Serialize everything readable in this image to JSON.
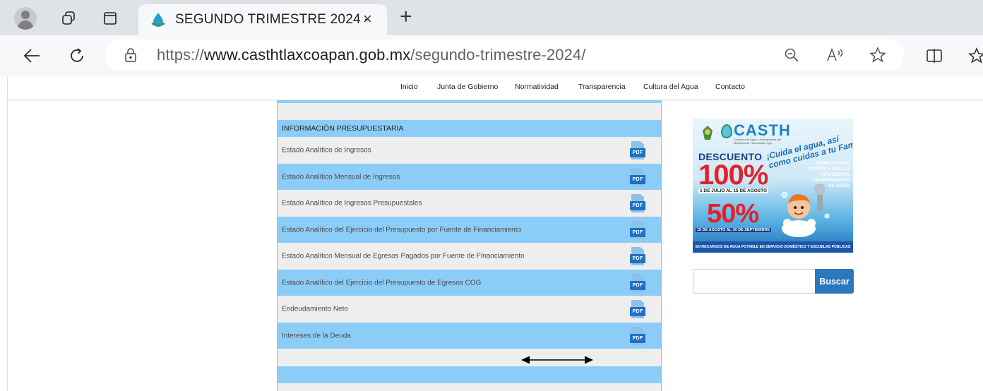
{
  "browser": {
    "tab_title": "SEGUNDO TRIMESTRE 2024 -",
    "tab_close_glyph": "×",
    "new_tab_glyph": "+",
    "url_scheme": "https://",
    "url_domain": "www.casthtlaxcoapan.gob.mx",
    "url_path": "/segundo-trimestre-2024/",
    "icons": [
      "profile-avatar",
      "workspaces-icon",
      "tab-actions-icon",
      "back-icon",
      "refresh-icon",
      "site-info-icon",
      "zoom-out-icon",
      "read-aloud-icon",
      "favorite-star-icon",
      "split-screen-icon",
      "favorites-icon"
    ]
  },
  "nav": {
    "items": [
      "Inicio",
      "Junta de Gobierno",
      "Normatividad",
      "Transparencia",
      "Cultura del Agua",
      "Contacto"
    ]
  },
  "table": {
    "header": "INFORMACIÓN PRESUPUESTARIA",
    "pdf_label": "PDF",
    "rows": [
      "Estado Analítico de Ingresos",
      "Estado Analítico Mensual de Ingresos",
      "Estado Analítico de Ingresos Presupuestales",
      "Estado Analítico del Ejercicio del Presupuesto por Fuente de Financiamiento",
      " Estado Analítico Mensual de Egresos Pagados por Fuente de Financiamiento",
      "Estado Analítico del Ejercicio del Presupuesto de Egresos COG",
      "Endeudamiento Neto",
      "Intereses de la Deuda"
    ],
    "colors": {
      "blue_row": "#8ccdf7",
      "gray_row": "#eeeeee",
      "pdf_icon": "#1d72c6"
    }
  },
  "banner": {
    "brand": "CASTH",
    "brand_sub": "Comisión de Agua y Saneamiento del Municipio de Tlaxcoapan, Hgo.",
    "slogan_line1": "¡Cuida el agua, así",
    "slogan_line2": "como cuidas a tu Familia!",
    "discount_word": "DESCUENTO",
    "discount_100": "100%",
    "date_range_1": "1 DE JULIO AL 15 DE AGOSTO",
    "tip_lines": [
      "TOMA DUCHAS",
      "CORTAS Y UTILIZA",
      "REGADERAS",
      "AHORRADORAS",
      "DE AGUA"
    ],
    "discount_50": "50%",
    "date_range_2": "15 DE AGOSTO AL 30 DE SEPTIEMBRE",
    "footer": "EN RECARGOS DE AGUA POTABLE EN SERVICIO DOMÉSTICO Y ESCUELAS PÚBLICAS"
  },
  "search": {
    "placeholder": "",
    "button_label": "Buscar"
  }
}
